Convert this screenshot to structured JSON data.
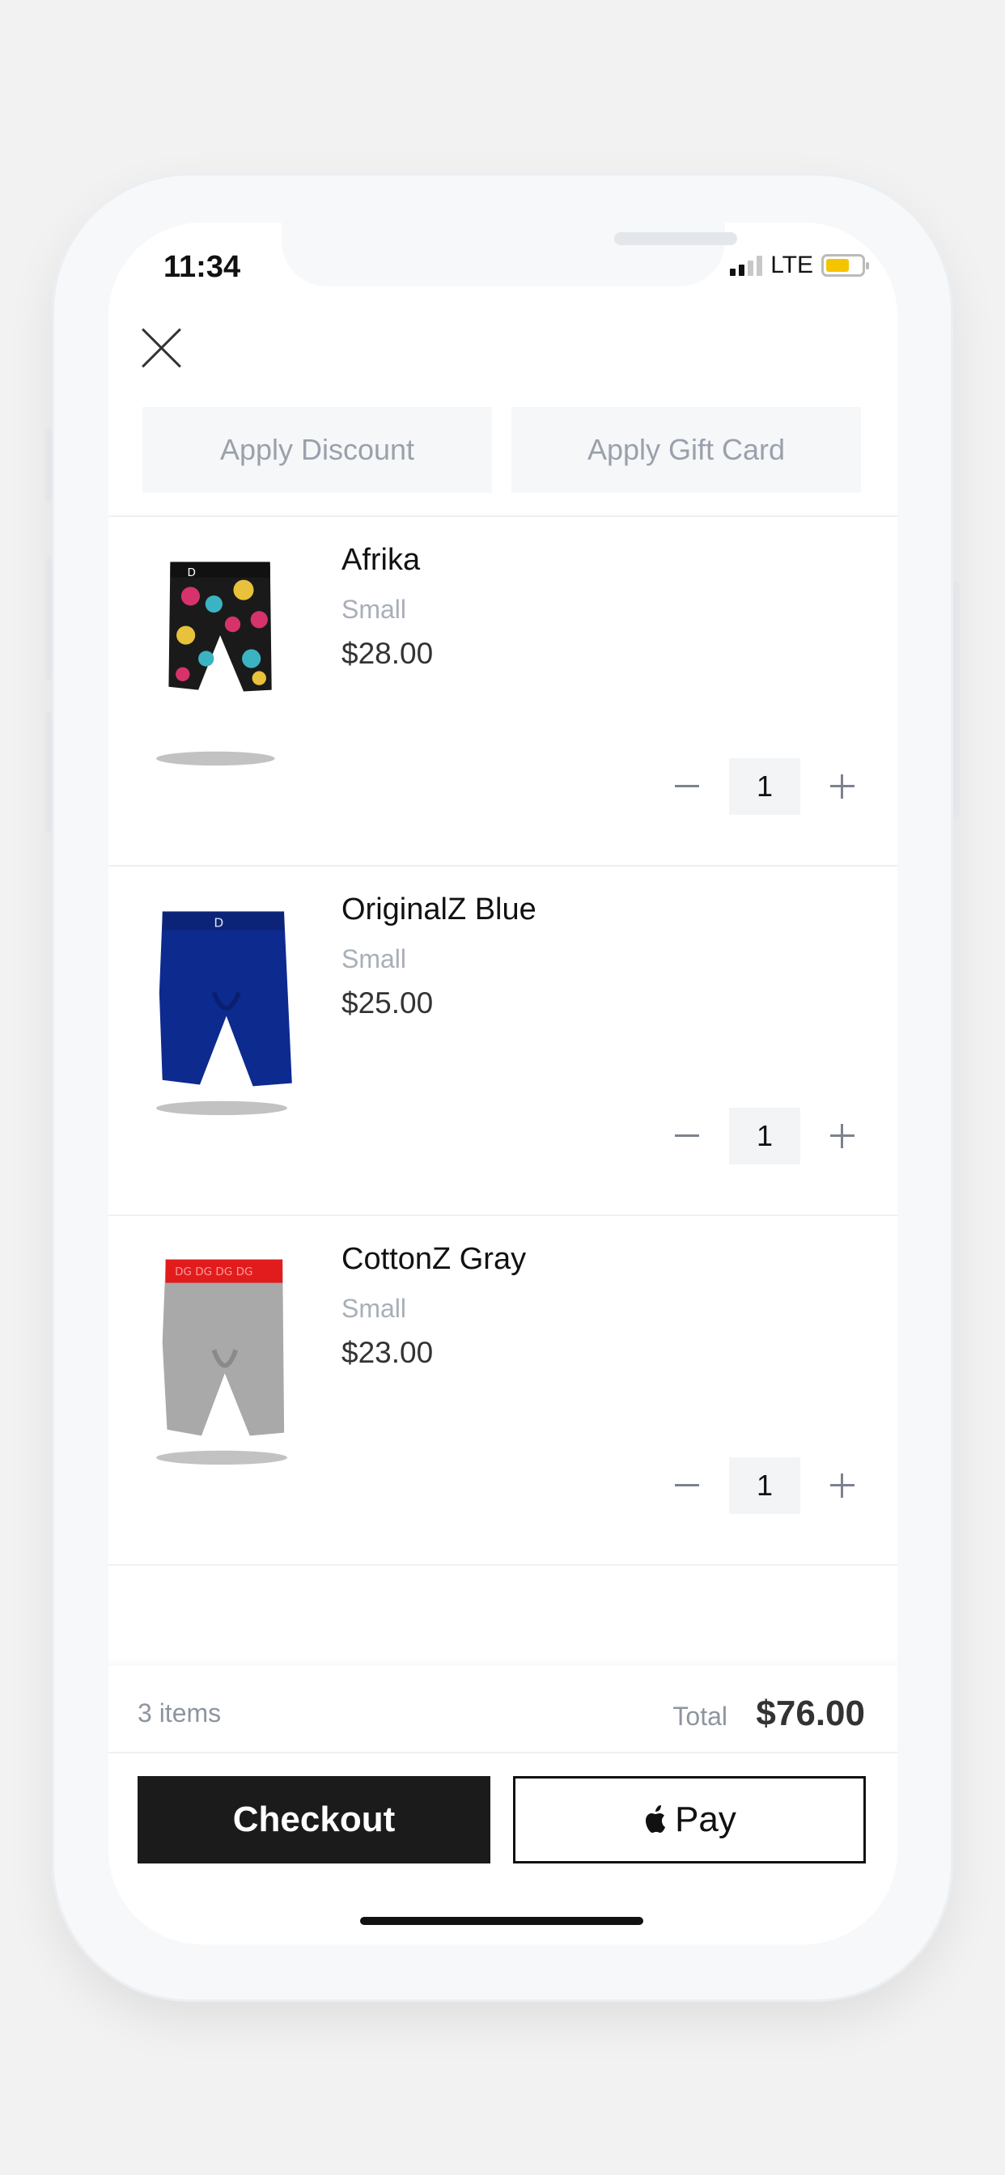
{
  "status_bar": {
    "time": "11:34",
    "network": "LTE"
  },
  "actions": {
    "apply_discount": "Apply Discount",
    "apply_gift_card": "Apply Gift Card"
  },
  "cart": {
    "items": [
      {
        "name": "Afrika",
        "size": "Small",
        "price": "$28.00",
        "quantity": "1"
      },
      {
        "name": "OriginalZ Blue",
        "size": "Small",
        "price": "$25.00",
        "quantity": "1"
      },
      {
        "name": "CottonZ Gray",
        "size": "Small",
        "price": "$23.00",
        "quantity": "1"
      }
    ]
  },
  "summary": {
    "items_count": "3 items",
    "total_label": "Total",
    "total_value": "$76.00"
  },
  "buttons": {
    "checkout": "Checkout",
    "apple_pay": "Pay"
  },
  "icons": [
    "close-icon",
    "minus-icon",
    "plus-icon",
    "apple-logo-icon",
    "signal-icon",
    "battery-icon"
  ],
  "colors": {
    "checkout_bg": "#1b1b1b",
    "battery": "#f5c400",
    "muted_text": "#9aa1ab"
  }
}
